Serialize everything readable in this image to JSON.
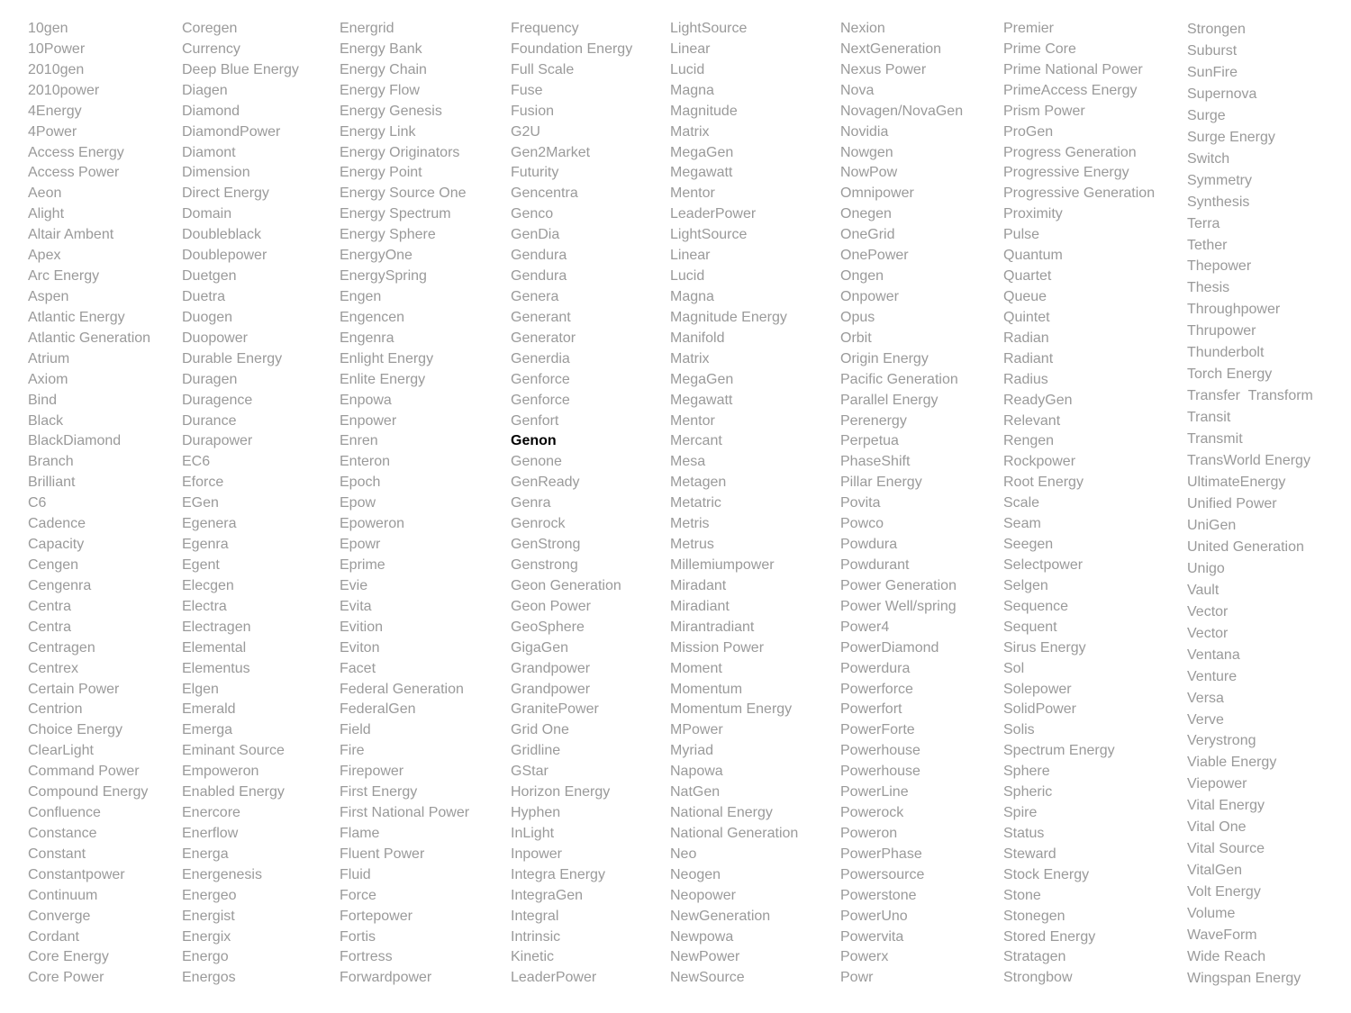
{
  "highlight": "Genon",
  "columns": [
    [
      "10gen",
      "10Power",
      "2010gen",
      "2010power",
      "4Energy",
      "4Power",
      "Access Energy",
      "Access Power",
      "Aeon",
      "Alight",
      "Altair Ambent",
      "Apex",
      "Arc Energy",
      "Aspen",
      "Atlantic Energy",
      "Atlantic Generation",
      "Atrium",
      "Axiom",
      "Bind",
      "Black",
      "BlackDiamond",
      "Branch",
      "Brilliant",
      "C6",
      "Cadence",
      "Capacity",
      "Cengen",
      "Cengenra",
      "Centra",
      "Centra",
      "Centragen",
      "Centrex",
      "Certain Power",
      "Centrion",
      "Choice Energy",
      "ClearLight",
      "Command Power",
      "Compound Energy",
      "Confluence",
      "Constance",
      "Constant",
      "Constantpower",
      "Continuum",
      "Converge",
      "Cordant",
      "Core Energy",
      "Core Power"
    ],
    [
      "Coregen",
      "Currency",
      "Deep Blue Energy",
      "Diagen",
      "Diamond",
      "DiamondPower",
      "Diamont",
      "Dimension",
      "Direct Energy",
      "Domain",
      "Doubleblack",
      "Doublepower",
      "Duetgen",
      "Duetra",
      "Duogen",
      "Duopower",
      "Durable Energy",
      "Duragen",
      "Duragence",
      "Durance",
      "Durapower",
      "EC6",
      "Eforce",
      "EGen",
      "Egenera",
      "Egenra",
      "Egent",
      "Elecgen",
      "Electra",
      "Electragen",
      "Elemental",
      "Elementus",
      "Elgen",
      "Emerald",
      "Emerga",
      "Eminant Source",
      "Empoweron",
      "Enabled Energy",
      "Enercore",
      "Enerflow",
      "Energa",
      "Energenesis",
      "Energeo",
      "Energist",
      "Energix",
      "Energo",
      "Energos"
    ],
    [
      "Energrid",
      "Energy Bank",
      "Energy Chain",
      "Energy Flow",
      "Energy Genesis",
      "Energy Link",
      "Energy Originators",
      "Energy Point",
      "Energy Source One",
      "Energy Spectrum",
      "Energy Sphere",
      "EnergyOne",
      "EnergySpring",
      "Engen",
      "Engencen",
      "Engenra",
      "Enlight Energy",
      "Enlite Energy",
      "Enpowa",
      "Enpower",
      "Enren",
      "Enteron",
      "Epoch",
      "Epow",
      "Epoweron",
      "Epowr",
      "Eprime",
      "Evie",
      "Evita",
      "Evition",
      "Eviton",
      "Facet",
      "Federal Generation",
      "FederalGen",
      "Field",
      "Fire",
      "Firepower",
      "First Energy",
      "First National Power",
      "Flame",
      "Fluent Power",
      "Fluid",
      "Force",
      "Fortepower",
      "Fortis",
      "Fortress",
      "Forwardpower"
    ],
    [
      "Frequency",
      "Foundation Energy",
      "Full Scale",
      "Fuse",
      "Fusion",
      "G2U",
      "Gen2Market",
      "Futurity",
      "Gencentra",
      "Genco",
      "GenDia",
      "Gendura",
      "Gendura",
      "Genera",
      "Generant",
      "Generator",
      "Generdia",
      "Genforce",
      "Genforce",
      "Genfort",
      "Genon",
      "Genone",
      "GenReady",
      "Genra",
      "Genrock",
      "GenStrong",
      "Genstrong",
      "Geon Generation",
      "Geon Power",
      "GeoSphere",
      "GigaGen",
      "Grandpower",
      "Grandpower",
      "GranitePower",
      "Grid One",
      "Gridline",
      "GStar",
      "Horizon Energy",
      "Hyphen",
      "InLight",
      "Inpower",
      "Integra Energy",
      "IntegraGen",
      "Integral",
      "Intrinsic",
      "Kinetic",
      "LeaderPower"
    ],
    [
      "LightSource",
      "Linear",
      "Lucid",
      "Magna",
      "Magnitude",
      "Matrix",
      "MegaGen",
      "Megawatt",
      "Mentor",
      "LeaderPower",
      "LightSource",
      "Linear",
      "Lucid",
      "Magna",
      "Magnitude Energy",
      "Manifold",
      "Matrix",
      "MegaGen",
      "Megawatt",
      "Mentor",
      "Mercant",
      "Mesa",
      "Metagen",
      "Metatric",
      "Metris",
      "Metrus",
      "Millemiumpower",
      "Miradant",
      "Miradiant",
      "Mirantradiant",
      "Mission Power",
      "Moment",
      "Momentum",
      "Momentum Energy",
      "MPower",
      "Myriad",
      "Napowa",
      "NatGen",
      "National Energy",
      "National Generation",
      "Neo",
      "Neogen",
      "Neopower",
      "NewGeneration",
      "Newpowa",
      "NewPower",
      "NewSource"
    ],
    [
      "Nexion",
      "NextGeneration",
      "Nexus Power",
      "Nova",
      "Novagen/NovaGen",
      "Novidia",
      "Nowgen",
      "NowPow",
      "Omnipower",
      "Onegen",
      "OneGrid",
      "OnePower",
      "Ongen",
      "Onpower",
      "Opus",
      "Orbit",
      "Origin Energy",
      "Pacific Generation",
      "Parallel Energy",
      "Perenergy",
      "Perpetua",
      "PhaseShift",
      "Pillar Energy",
      "Povita",
      "Powco",
      "Powdura",
      "Powdurant",
      "Power Generation",
      "Power Well/spring",
      "Power4",
      "PowerDiamond",
      "Powerdura",
      "Powerforce",
      "Powerfort",
      "PowerForte",
      "Powerhouse",
      "Powerhouse",
      "PowerLine",
      "Powerock",
      "Poweron",
      "PowerPhase",
      "Powersource",
      "Powerstone",
      "PowerUno",
      "Powervita",
      "Powerx",
      "Powr"
    ],
    [
      "Premier",
      "Prime Core",
      "Prime National Power",
      "PrimeAccess Energy",
      "Prism Power",
      "ProGen",
      "Progress Generation",
      "Progressive Energy",
      "Progressive Generation",
      "Proximity",
      "Pulse",
      "Quantum",
      "Quartet",
      "Queue",
      "Quintet",
      "Radian",
      "Radiant",
      "Radius",
      "ReadyGen",
      "Relevant",
      "Rengen",
      "Rockpower",
      "Root Energy",
      "Scale",
      "Seam",
      "Seegen",
      "Selectpower",
      "Selgen",
      "Sequence",
      "Sequent",
      "Sirus Energy",
      "Sol",
      "Solepower",
      "SolidPower",
      "Solis",
      "Spectrum Energy",
      "Sphere",
      "Spheric",
      "Spire",
      "Status",
      "Steward",
      "Stock Energy",
      "Stone",
      "Stonegen",
      "Stored Energy",
      "Stratagen",
      "Strongbow"
    ],
    [
      "Strongen",
      "Suburst",
      "SunFire",
      "Supernova",
      "Surge",
      "Surge Energy",
      "Switch",
      "Symmetry",
      "Synthesis",
      "Terra",
      "Tether",
      "Thepower",
      "Thesis",
      "Throughpower",
      "Thrupower",
      "Thunderbolt",
      "Torch Energy",
      "Transfer  Transform",
      "Transit",
      "Transmit",
      "TransWorld Energy",
      "UltimateEnergy",
      "Unified Power",
      "UniGen",
      "United Generation",
      "Unigo",
      "Vault",
      "Vector",
      "Vector",
      "Ventana",
      "Venture",
      "Versa",
      "Verve",
      "Verystrong",
      "Viable Energy",
      "Viepower",
      "Vital Energy",
      "Vital One",
      "Vital Source",
      "VitalGen",
      "Volt Energy",
      "Volume",
      "WaveForm",
      "Wide Reach",
      "Wingspan Energy"
    ]
  ]
}
